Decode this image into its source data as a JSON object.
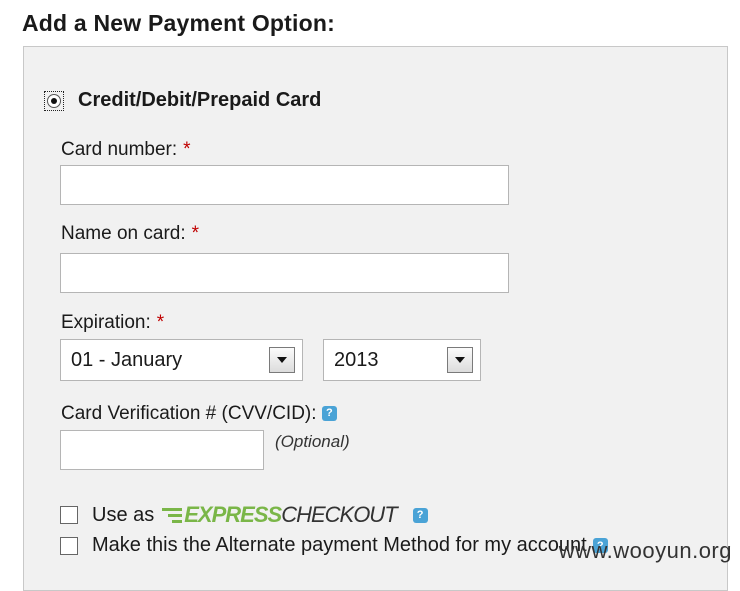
{
  "title": "Add a New Payment Option:",
  "payment_type": {
    "label": "Credit/Debit/Prepaid Card",
    "selected": true
  },
  "required_marker": "*",
  "fields": {
    "card_number": {
      "label": "Card number:",
      "value": ""
    },
    "name_on_card": {
      "label": "Name on card:",
      "value": ""
    },
    "expiration": {
      "label": "Expiration:",
      "month_value": "01 - January",
      "year_value": "2013"
    },
    "cvv": {
      "label": "Card Verification # (CVV/CID):",
      "value": "",
      "note": "(Optional)"
    }
  },
  "help_icon_text": "?",
  "checkboxes": {
    "express": {
      "prefix": "Use as",
      "logo_express": "EXPRESS",
      "logo_checkout": "CHECKOUT",
      "checked": false
    },
    "alternate": {
      "label": "Make this the Alternate payment Method for my account",
      "checked": false
    }
  },
  "watermark": "www.wooyun.org",
  "icons": [
    "radio-button",
    "dropdown-arrow-icon",
    "help-icon",
    "express-checkout-logo"
  ],
  "colors": {
    "required": "#c00000",
    "help_icon": "#4aa3d6",
    "express_green": "#7ab648",
    "panel_bg": "#f1f1f1"
  }
}
